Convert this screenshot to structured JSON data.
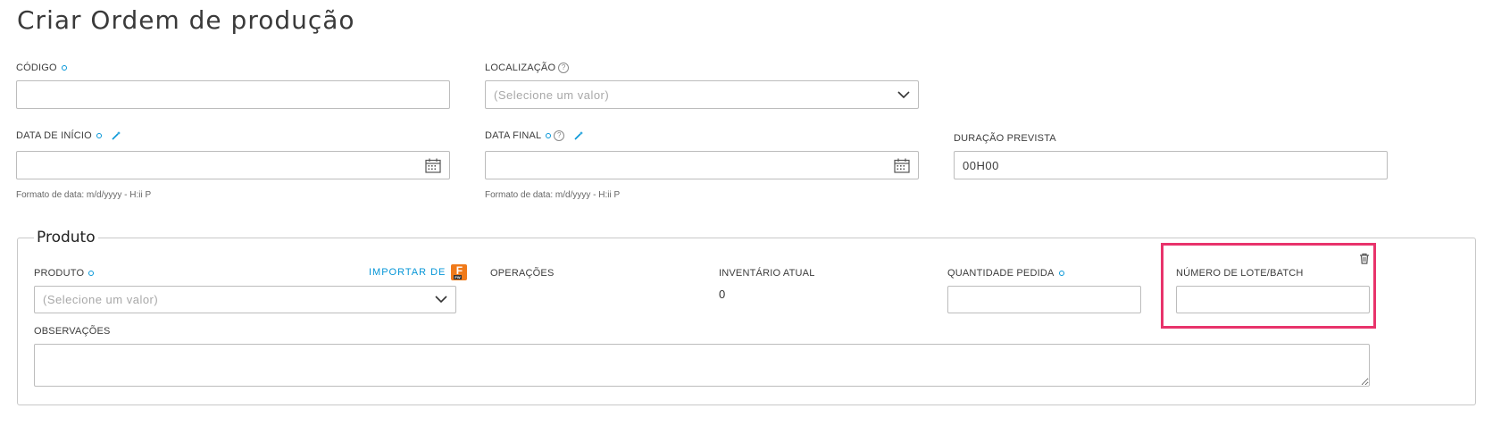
{
  "page": {
    "title": "Criar Ordem de produção"
  },
  "fields": {
    "codigo": {
      "label": "CÓDIGO",
      "value": ""
    },
    "localizacao": {
      "label": "LOCALIZAÇÃO",
      "placeholder": "(Selecione um valor)"
    },
    "data_inicio": {
      "label": "DATA DE INÍCIO",
      "value": "",
      "format_hint": "Formato de data: m/d/yyyy - H:ii P"
    },
    "data_final": {
      "label": "DATA FINAL",
      "value": "",
      "format_hint": "Formato de data: m/d/yyyy - H:ii P"
    },
    "duracao": {
      "label": "DURAÇÃO PREVISTA",
      "value": "00H00"
    }
  },
  "produto_section": {
    "legend": "Produto",
    "produto": {
      "label": "PRODUTO",
      "placeholder": "(Selecione um valor)"
    },
    "importar_label": "IMPORTAR DE",
    "import_badge": {
      "letter": "F",
      "sub": "FW",
      "color": "#f07a1a"
    },
    "operacoes_label": "OPERAÇÕES",
    "inventario": {
      "label": "INVENTÁRIO ATUAL",
      "value": "0"
    },
    "quantidade": {
      "label": "QUANTIDADE PEDIDA",
      "value": ""
    },
    "lote": {
      "label": "NÚMERO DE LOTE/BATCH",
      "value": ""
    },
    "observacoes": {
      "label": "OBSERVAÇÕES",
      "value": ""
    }
  },
  "icons": {
    "required": "required-dot-icon",
    "help": "help-icon",
    "wand": "magic-wand-icon",
    "calendar": "calendar-icon",
    "chevron": "chevron-down-icon",
    "trash": "trash-icon"
  },
  "colors": {
    "accent": "#0696d7",
    "highlight": "#e8336b"
  },
  "help_glyph": "?"
}
